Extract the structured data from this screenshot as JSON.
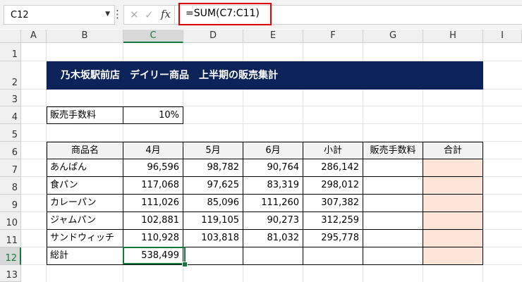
{
  "name_box": "C12",
  "formula_bar": {
    "cancel_icon": "✕",
    "enter_icon": "✓",
    "fx_label": "fx",
    "formula": "=SUM(C7:C11)"
  },
  "columns": [
    "A",
    "B",
    "C",
    "D",
    "E",
    "F",
    "G",
    "H",
    "I"
  ],
  "rows": [
    "1",
    "2",
    "3",
    "4",
    "5",
    "6",
    "7",
    "8",
    "9",
    "10",
    "11",
    "12",
    "13"
  ],
  "title": "乃木坂駅前店　デイリー商品　上半期の販売集計",
  "fee": {
    "label": "販売手数料",
    "value": "10%"
  },
  "table": {
    "headers": [
      "商品名",
      "4月",
      "5月",
      "6月",
      "小計",
      "販売手数料",
      "合計"
    ],
    "rows": [
      [
        "あんぱん",
        "96,596",
        "98,782",
        "90,764",
        "286,142",
        "",
        ""
      ],
      [
        "食パン",
        "117,068",
        "97,625",
        "83,319",
        "298,012",
        "",
        ""
      ],
      [
        "カレーパン",
        "111,026",
        "85,096",
        "111,260",
        "307,382",
        "",
        ""
      ],
      [
        "ジャムパン",
        "102,881",
        "119,105",
        "90,273",
        "312,259",
        "",
        ""
      ],
      [
        "サンドウィッチ",
        "110,928",
        "103,818",
        "81,032",
        "295,778",
        "",
        ""
      ]
    ],
    "total": [
      "総計",
      "538,499",
      "",
      "",
      "",
      "",
      ""
    ]
  },
  "colors": {
    "title_band": "#0b2358",
    "total_col_fill": "#fce4d6",
    "selection": "#117a3c",
    "formula_highlight": "#e00000"
  }
}
